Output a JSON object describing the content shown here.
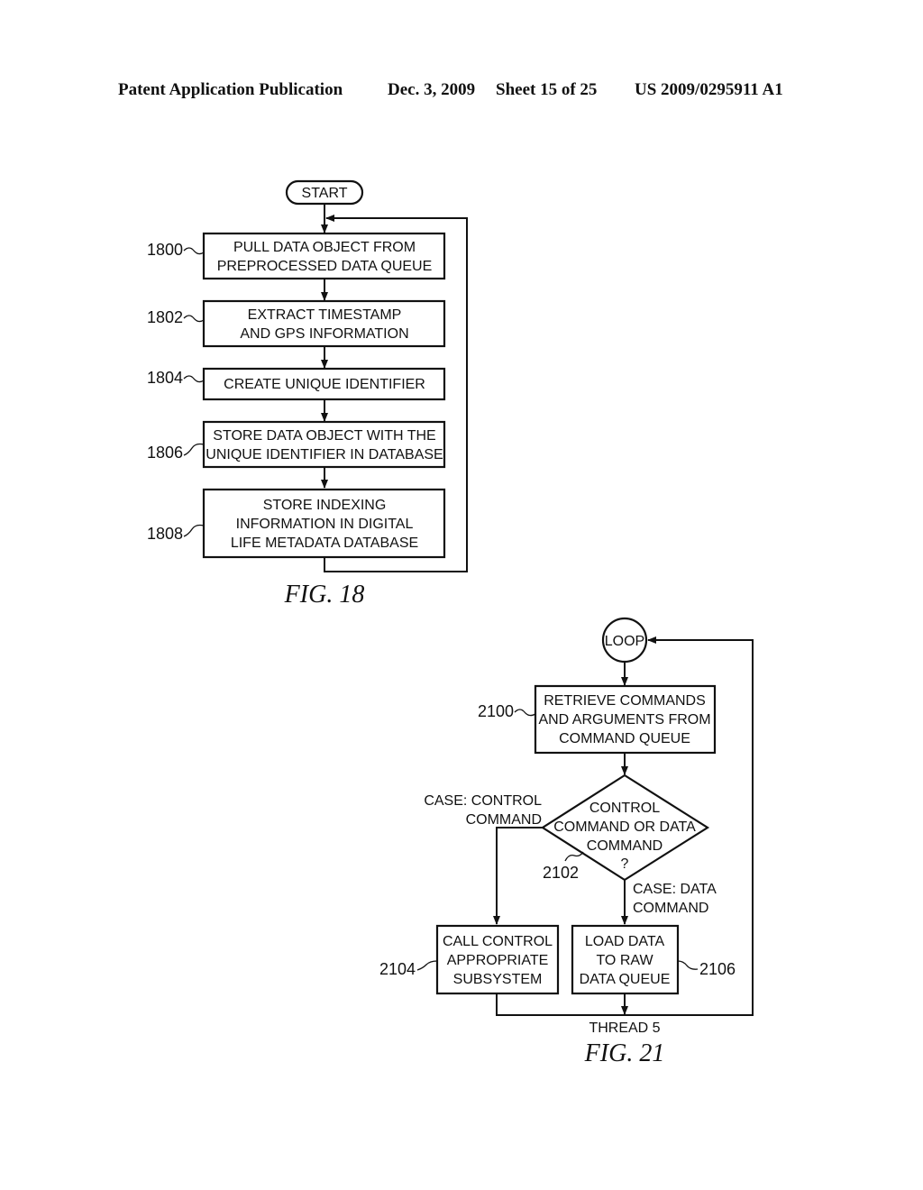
{
  "header": {
    "left": "Patent Application Publication",
    "date": "Dec. 3, 2009",
    "sheet": "Sheet 15 of 25",
    "number": "US 2009/0295911 A1"
  },
  "fig18": {
    "caption": "FIG. 18",
    "start_label": "START",
    "steps": [
      {
        "ref": "1800",
        "lines": [
          "PULL DATA OBJECT FROM",
          "PREPROCESSED DATA QUEUE"
        ]
      },
      {
        "ref": "1802",
        "lines": [
          "EXTRACT TIMESTAMP",
          "AND GPS INFORMATION"
        ]
      },
      {
        "ref": "1804",
        "lines": [
          "CREATE UNIQUE IDENTIFIER"
        ]
      },
      {
        "ref": "1806",
        "lines": [
          "STORE DATA OBJECT WITH THE",
          "UNIQUE IDENTIFIER IN DATABASE"
        ]
      },
      {
        "ref": "1808",
        "lines": [
          "STORE INDEXING",
          "INFORMATION IN DIGITAL",
          "LIFE METADATA DATABASE"
        ]
      }
    ]
  },
  "fig21": {
    "caption": "FIG. 21",
    "loop_label": "LOOP",
    "retrieve": {
      "ref": "2100",
      "lines": [
        "RETRIEVE COMMANDS",
        "AND ARGUMENTS FROM",
        "COMMAND QUEUE"
      ]
    },
    "decision": {
      "ref": "2102",
      "lines": [
        "CONTROL",
        "COMMAND OR DATA",
        "COMMAND",
        "?"
      ]
    },
    "case_control": [
      "CASE: CONTROL",
      "COMMAND"
    ],
    "case_data": [
      "CASE: DATA",
      "COMMAND"
    ],
    "call_control": {
      "ref": "2104",
      "lines": [
        "CALL CONTROL",
        "APPROPRIATE",
        "SUBSYSTEM"
      ]
    },
    "load_data": {
      "ref": "2106",
      "lines": [
        "LOAD DATA",
        "TO RAW",
        "DATA QUEUE"
      ]
    },
    "thread_label": "THREAD 5"
  }
}
